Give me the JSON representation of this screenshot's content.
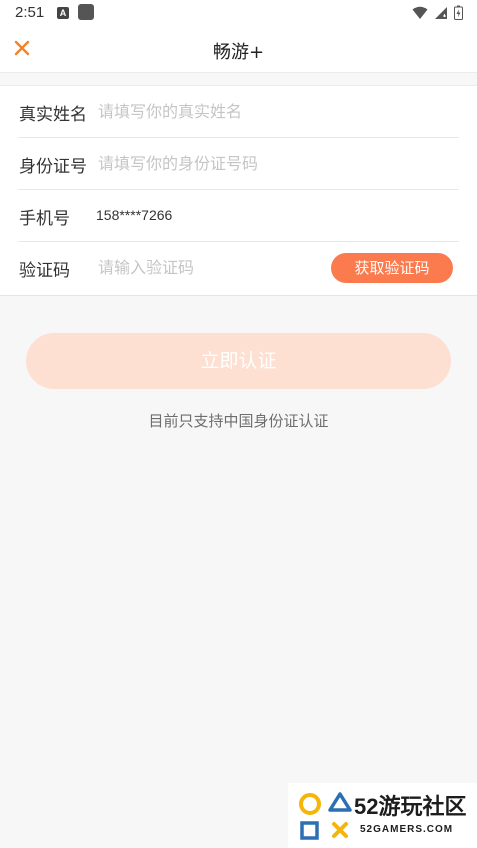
{
  "status_bar": {
    "time": "2:51",
    "notification_letter": "A",
    "icons": [
      "wifi-icon",
      "signal-icon",
      "battery-icon"
    ]
  },
  "header": {
    "close_icon": "close-icon",
    "title": "畅游+"
  },
  "form": {
    "real_name": {
      "label": "真实姓名",
      "placeholder": "请填写你的真实姓名"
    },
    "id_number": {
      "label": "身份证号",
      "placeholder": "请填写你的身份证号码"
    },
    "phone": {
      "label": "手机号",
      "value": "158****7266"
    },
    "code": {
      "label": "验证码",
      "placeholder": "请输入验证码",
      "button_label": "获取验证码"
    }
  },
  "submit_label": "立即认证",
  "notice": "目前只支持中国身份证认证",
  "watermark": {
    "name": "52游玩社区",
    "domain": "52GAMERS.COM"
  },
  "colors": {
    "accent": "#fb7b4f",
    "close": "#f5822b",
    "submit_disabled": "#fde0d2",
    "background": "#f7f7f7"
  }
}
